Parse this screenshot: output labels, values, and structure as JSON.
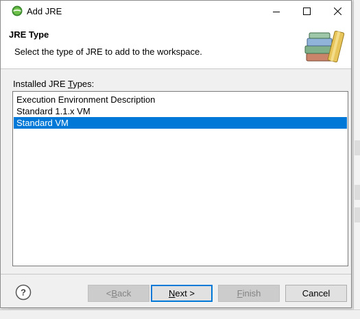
{
  "window": {
    "title": "Add JRE",
    "icons": {
      "app": "eclipse-icon",
      "minimize": "minimize-icon",
      "maximize": "maximize-icon",
      "close": "close-icon"
    }
  },
  "header": {
    "title": "JRE Type",
    "description": "Select the type of JRE to add to the workspace.",
    "image": "library-books-icon"
  },
  "jre_types": {
    "label_pre": "Installed JRE ",
    "label_mnemonic": "T",
    "label_post": "ypes:",
    "items": [
      {
        "label": "Execution Environment Description",
        "selected": false
      },
      {
        "label": "Standard 1.1.x VM",
        "selected": false
      },
      {
        "label": "Standard VM",
        "selected": true
      }
    ]
  },
  "buttons": {
    "help_icon": "help-icon",
    "back_pre": "< ",
    "back_mnemonic": "B",
    "back_post": "ack",
    "next_mnemonic": "N",
    "next_post": "ext >",
    "finish_mnemonic": "F",
    "finish_post": "inish",
    "cancel": "Cancel"
  },
  "colors": {
    "selection": "#0078d7",
    "header_bg": "#ffffff",
    "dialog_bg": "#f0f0f0"
  }
}
